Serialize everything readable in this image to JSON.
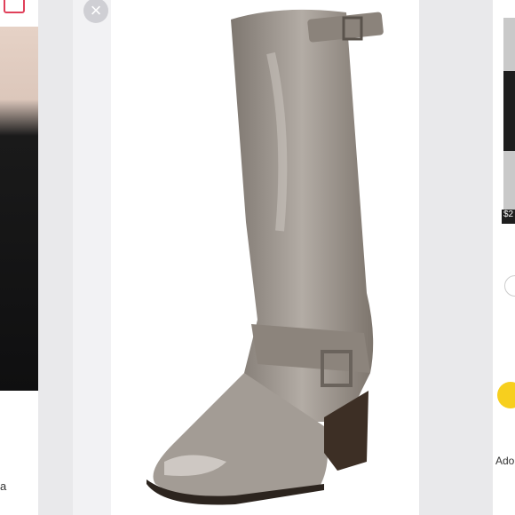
{
  "close_icon": "×",
  "left_panel": {
    "caption": "a"
  },
  "right_panel": {
    "price": "$2",
    "caption": "Ado"
  },
  "boot_colors": {
    "leather": "#9a9189",
    "highlight": "#c9c3bd",
    "heel": "#3d2f25"
  }
}
